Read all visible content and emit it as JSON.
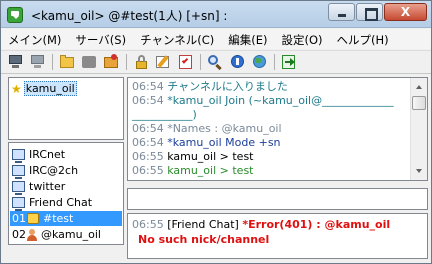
{
  "window": {
    "title": "<kamu_oil> @#test(1人) [+sn] :",
    "close_glyph": "X"
  },
  "menu": [
    {
      "label": "メイン(M)"
    },
    {
      "label": "サーバ(S)"
    },
    {
      "label": "チャンネル(C)"
    },
    {
      "label": "編集(E)"
    },
    {
      "label": "設定(O)"
    },
    {
      "label": "ヘルプ(H)"
    }
  ],
  "toolbar": {
    "icons": [
      "connect-icon",
      "disconnect-icon",
      "open-folder-icon",
      "channel-icon",
      "leave-icon",
      "lock-icon",
      "edit-icon",
      "checklist-icon",
      "search-icon",
      "info-icon",
      "globe-icon",
      "exit-icon"
    ]
  },
  "channels": {
    "active": "kamu_oil"
  },
  "tree": {
    "servers": [
      "IRCnet",
      "IRC@2ch",
      "twitter",
      "Friend Chat"
    ],
    "channel_items": [
      {
        "index": "01",
        "name": "#test"
      },
      {
        "index": "02",
        "name": "@kamu_oil"
      }
    ]
  },
  "log": [
    {
      "time": "06:54",
      "text": "チャンネルに入りました"
    },
    {
      "time": "06:54",
      "text": "*kamu_oil Join (~kamu_oil@_____________"
    },
    {
      "time": "",
      "text": "___________)"
    },
    {
      "time": "06:54",
      "text": "*Names : @kamu_oil"
    },
    {
      "time": "06:54",
      "text": "*kamu_oil Mode +sn"
    },
    {
      "time": "06:55",
      "text": "kamu_oil > test"
    },
    {
      "time": "06:55",
      "text": "kamu_oil > test"
    }
  ],
  "input": {
    "value": ""
  },
  "system": {
    "time": "06:55",
    "tag": "[Friend Chat]",
    "error": "*Error(401) : @kamu_oil",
    "detail": "No such nick/channel"
  },
  "colors": {
    "selection": "#3399ff",
    "error": "#e01010",
    "join": "#1e7a8a",
    "message": "#2a8a2a"
  }
}
